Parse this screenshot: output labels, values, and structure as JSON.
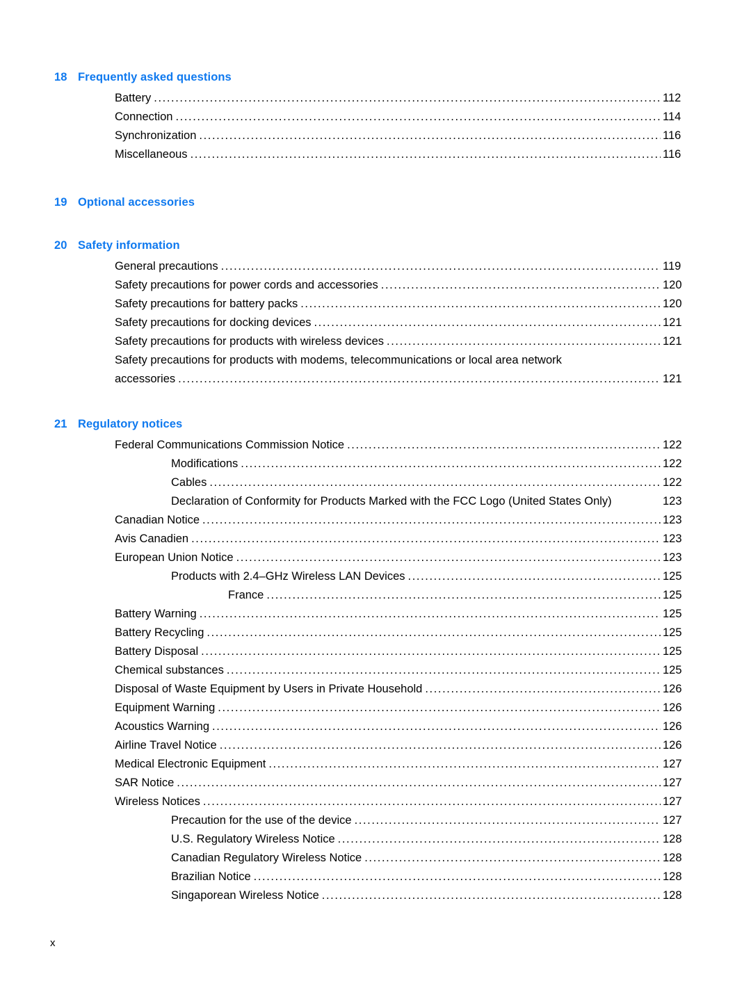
{
  "document": {
    "type": "table-of-contents",
    "footer_page_number": "x",
    "heading_color": "#0f79ef",
    "text_color": "#000000",
    "background_color": "#ffffff"
  },
  "chapters": [
    {
      "number": "18",
      "title": "Frequently asked questions",
      "entries": [
        {
          "level": 1,
          "label": "Battery",
          "page": "112",
          "leader": true
        },
        {
          "level": 1,
          "label": "Connection",
          "page": "114",
          "leader": true
        },
        {
          "level": 1,
          "label": "Synchronization",
          "page": "116",
          "leader": true
        },
        {
          "level": 1,
          "label": "Miscellaneous",
          "page": "116",
          "leader": true
        }
      ]
    },
    {
      "number": "19",
      "title": "Optional accessories",
      "entries": []
    },
    {
      "number": "20",
      "title": "Safety information",
      "entries": [
        {
          "level": 1,
          "label": "General precautions",
          "page": "119",
          "leader": true
        },
        {
          "level": 1,
          "label": "Safety precautions for power cords and accessories",
          "page": "120",
          "leader": true
        },
        {
          "level": 1,
          "label": "Safety precautions for battery packs",
          "page": "120",
          "leader": true
        },
        {
          "level": 1,
          "label": "Safety precautions for docking devices",
          "page": "121",
          "leader": true
        },
        {
          "level": 1,
          "label": "Safety precautions for products with wireless devices",
          "page": "121",
          "leader": true
        },
        {
          "level": 1,
          "wrapped": true,
          "line1": "Safety precautions for products with modems, telecommunications or local area network",
          "label": "accessories",
          "page": "121",
          "leader": true
        }
      ]
    },
    {
      "number": "21",
      "title": "Regulatory notices",
      "entries": [
        {
          "level": 1,
          "label": "Federal Communications Commission Notice",
          "page": "122",
          "leader": true
        },
        {
          "level": 2,
          "label": "Modifications",
          "page": "122",
          "leader": true
        },
        {
          "level": 2,
          "label": "Cables",
          "page": "122",
          "leader": true
        },
        {
          "level": 2,
          "label": "Declaration of Conformity for Products Marked with the FCC Logo (United States Only)",
          "page": "123",
          "leader": false
        },
        {
          "level": 1,
          "label": "Canadian Notice",
          "page": "123",
          "leader": true
        },
        {
          "level": 1,
          "label": "Avis Canadien",
          "page": "123",
          "leader": true
        },
        {
          "level": 1,
          "label": "European Union Notice",
          "page": "123",
          "leader": true
        },
        {
          "level": 2,
          "label": "Products with 2.4–GHz Wireless LAN Devices",
          "page": "125",
          "leader": true
        },
        {
          "level": 3,
          "label": "France",
          "page": "125",
          "leader": true
        },
        {
          "level": 1,
          "label": "Battery Warning",
          "page": "125",
          "leader": true
        },
        {
          "level": 1,
          "label": "Battery Recycling",
          "page": "125",
          "leader": true
        },
        {
          "level": 1,
          "label": "Battery Disposal",
          "page": "125",
          "leader": true
        },
        {
          "level": 1,
          "label": "Chemical substances",
          "page": "125",
          "leader": true
        },
        {
          "level": 1,
          "label": "Disposal of Waste Equipment by Users in Private Household",
          "page": "126",
          "leader": true
        },
        {
          "level": 1,
          "label": "Equipment Warning",
          "page": "126",
          "leader": true
        },
        {
          "level": 1,
          "label": "Acoustics Warning",
          "page": "126",
          "leader": true
        },
        {
          "level": 1,
          "label": "Airline Travel Notice",
          "page": "126",
          "leader": true
        },
        {
          "level": 1,
          "label": "Medical Electronic Equipment",
          "page": "127",
          "leader": true
        },
        {
          "level": 1,
          "label": "SAR Notice",
          "page": "127",
          "leader": true
        },
        {
          "level": 1,
          "label": "Wireless Notices",
          "page": "127",
          "leader": true
        },
        {
          "level": 2,
          "label": "Precaution for the use of the device ",
          "page": "127",
          "leader": true
        },
        {
          "level": 2,
          "label": "U.S. Regulatory Wireless Notice",
          "page": "128",
          "leader": true
        },
        {
          "level": 2,
          "label": "Canadian Regulatory Wireless Notice",
          "page": "128",
          "leader": true
        },
        {
          "level": 2,
          "label": "Brazilian Notice",
          "page": "128",
          "leader": true
        },
        {
          "level": 2,
          "label": "Singaporean Wireless Notice",
          "page": "128",
          "leader": true
        }
      ]
    }
  ]
}
